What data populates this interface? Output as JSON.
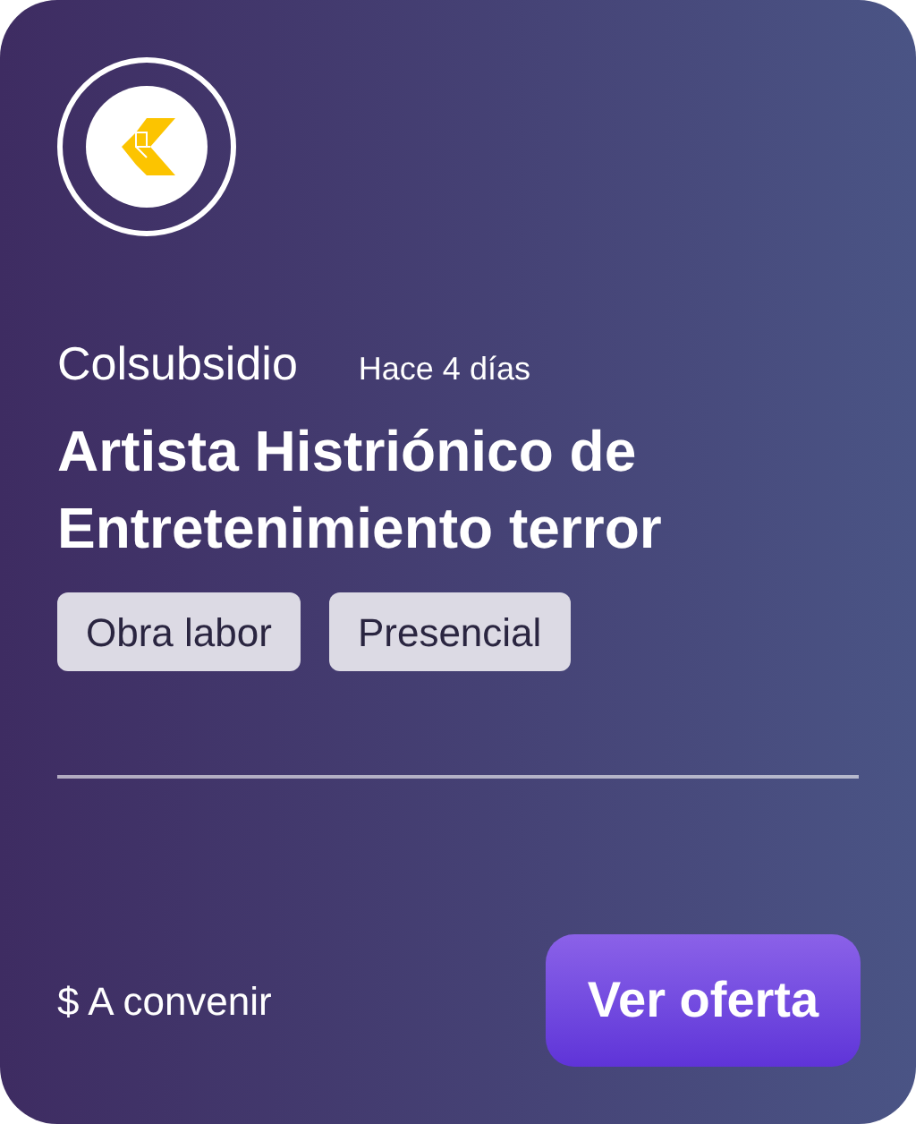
{
  "company": "Colsubsidio",
  "posted": "Hace 4 días",
  "title": "Artista Histriónico de Entretenimiento terror",
  "tags": [
    "Obra labor",
    "Presencial"
  ],
  "salary": "$ A convenir",
  "button": "Ver oferta"
}
